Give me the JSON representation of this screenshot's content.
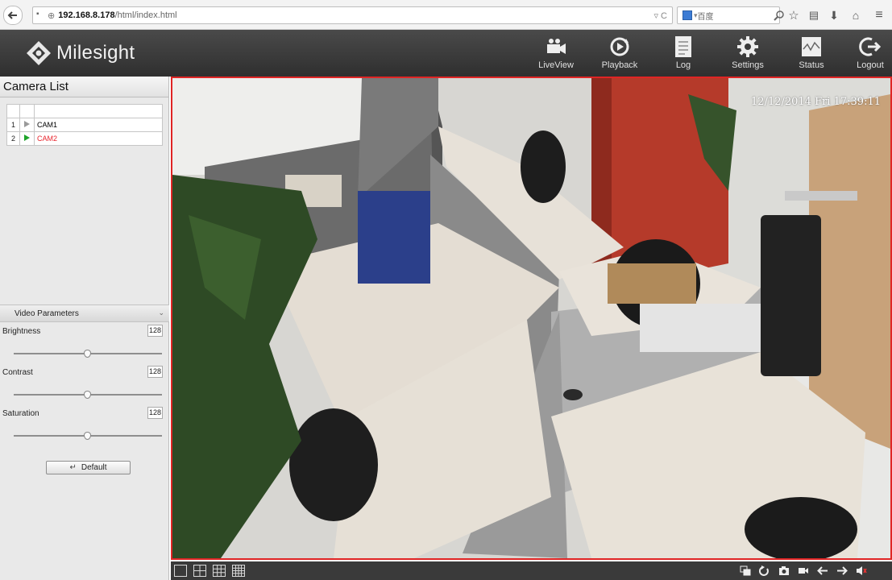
{
  "browser": {
    "url_host": "192.168.8.178",
    "url_path": "/html/index.html",
    "search_engine_label": "百度",
    "icons": [
      "back-icon",
      "info-icon",
      "globe-icon",
      "reload-icon",
      "search-icon",
      "star-icon",
      "bookmark-list-icon",
      "download-icon",
      "home-icon",
      "menu-icon"
    ]
  },
  "header": {
    "brand": "Milesight",
    "nav": [
      {
        "label": "LiveView",
        "icon": "video-camera-icon"
      },
      {
        "label": "Playback",
        "icon": "playback-icon"
      },
      {
        "label": "Log",
        "icon": "log-icon"
      },
      {
        "label": "Settings",
        "icon": "gear-icon"
      },
      {
        "label": "Status",
        "icon": "status-wave-icon"
      },
      {
        "label": "Logout",
        "icon": "logout-icon"
      }
    ]
  },
  "camera_list": {
    "title": "Camera List",
    "rows": [
      {
        "num": "1",
        "name": "CAM1",
        "active": false
      },
      {
        "num": "2",
        "name": "CAM2",
        "active": true
      }
    ]
  },
  "video_params": {
    "title": "Video Parameters",
    "items": [
      {
        "label": "Brightness",
        "value": "128",
        "level": 0.5
      },
      {
        "label": "Contrast",
        "value": "128",
        "level": 0.5
      },
      {
        "label": "Saturation",
        "value": "128",
        "level": 0.5
      }
    ],
    "default_label": "Default"
  },
  "video": {
    "osd_text": "12/12/2014 Fri 17:39:11"
  },
  "toolbar": {
    "layouts": [
      "1x1",
      "2x2",
      "3x3",
      "4x4"
    ],
    "controls": [
      "fullscreen-icon",
      "rotate-icon",
      "snapshot-icon",
      "record-icon",
      "previous-icon",
      "next-icon",
      "audio-icon"
    ]
  },
  "colors": {
    "active_camera": "#e8242c",
    "video_border": "#e02525",
    "header_bg": "#3a3a3a"
  }
}
